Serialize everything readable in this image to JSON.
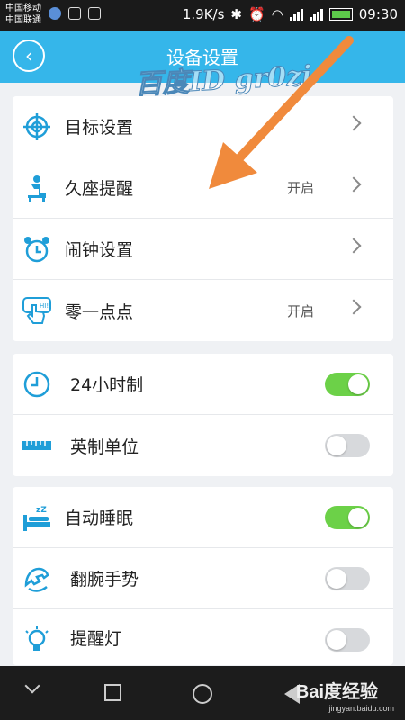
{
  "status_bar": {
    "carrier_1": "中国移动",
    "carrier_2": "中国联通",
    "network_speed": "1.9K/s",
    "net_type": "2G",
    "net_type_2": "H",
    "time": "09:30"
  },
  "header": {
    "title": "设备设置",
    "watermark": "百度ID gr0zi",
    "accent_color": "#35b6ea"
  },
  "group_1": [
    {
      "label": "目标设置",
      "value": "",
      "icon": "target-icon"
    },
    {
      "label": "久座提醒",
      "value": "开启",
      "icon": "sitting-person-icon"
    },
    {
      "label": "闹钟设置",
      "value": "",
      "icon": "alarm-clock-icon"
    },
    {
      "label": "零一点点",
      "value": "开启",
      "icon": "touch-hi-icon"
    }
  ],
  "group_2": [
    {
      "label": "24小时制",
      "toggle": true,
      "icon": "clock-icon"
    },
    {
      "label": "英制单位",
      "toggle": false,
      "icon": "ruler-icon"
    }
  ],
  "group_3": [
    {
      "label": "自动睡眠",
      "toggle": true,
      "icon": "sleep-bed-icon"
    },
    {
      "label": "翻腕手势",
      "toggle": false,
      "icon": "wrist-flip-icon"
    },
    {
      "label": "提醒灯",
      "toggle": false,
      "icon": "light-bulb-icon"
    }
  ],
  "footer": {
    "baidu_mark": "Bai度经验",
    "baidu_url": "jingyan.baidu.com"
  },
  "colors": {
    "toggle_on": "#6cd148",
    "toggle_off": "#d7d9dc",
    "arrow": "#f08a3c",
    "icon": "#1f9ed8"
  }
}
